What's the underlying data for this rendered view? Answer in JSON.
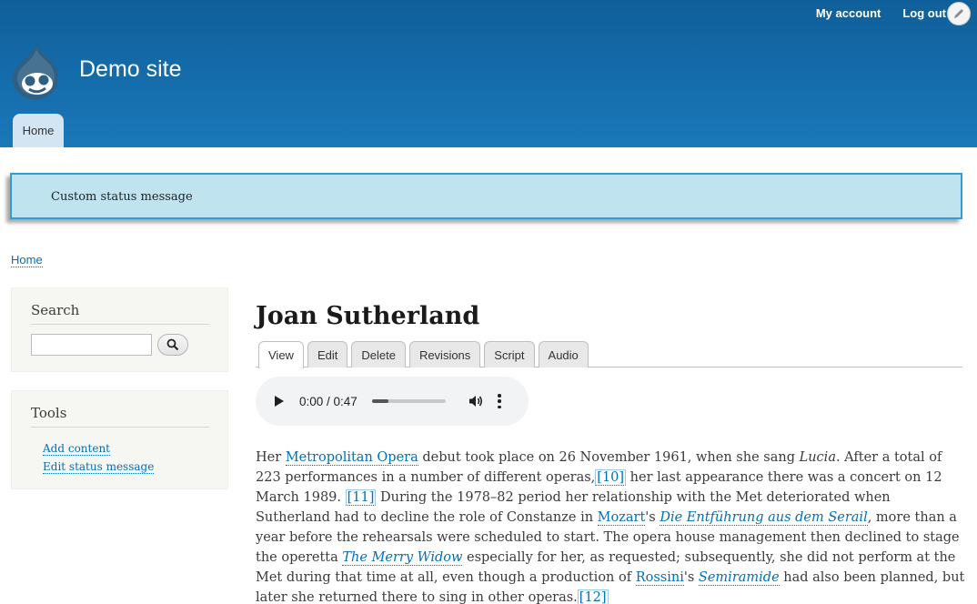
{
  "header": {
    "site_name": "Demo site",
    "secondary_menu": [
      "My account",
      "Log out"
    ],
    "primary_menu": [
      "Home"
    ],
    "colors": {
      "brand_top": "#0f5f9a",
      "brand_bottom": "#1a78b9"
    }
  },
  "status_message": "Custom status message",
  "breadcrumb": [
    "Home"
  ],
  "sidebar": {
    "search": {
      "title": "Search",
      "input_value": ""
    },
    "tools": {
      "title": "Tools",
      "links": [
        "Add content",
        "Edit status message"
      ]
    }
  },
  "main": {
    "title": "Joan Sutherland",
    "tabs": [
      "View",
      "Edit",
      "Delete",
      "Revisions",
      "Script",
      "Audio"
    ],
    "active_tab": "View",
    "audio": {
      "time": "0:00 / 0:47",
      "progress": 0.22
    },
    "body": {
      "t1": "Her ",
      "l1": "Metropolitan Opera",
      "t2": " debut took place on 26 November 1961, when she sang ",
      "i1": "Lucia",
      "t3": ". After a total of 223 performances in a number of different operas,",
      "r10": "[10]",
      "t4": " her last appearance there was a concert on 12 March 1989. ",
      "r11": "[11]",
      "t5": " During the 1978–82 period her relationship with the Met deteriorated when Sutherland had to decline the role of Constanze in ",
      "l2": "Mozart",
      "t6": "'s ",
      "l3": "Die Entführung aus dem Serail",
      "t7": ", more than a year before the rehearsals were scheduled to start. The opera house management then declined to stage the operetta ",
      "l4": "The Merry Widow",
      "t8": " especially for her, as requested; subsequently, she did not perform at the Met during that time at all, even though a production of ",
      "l5": "Rossini",
      "t9": "'s ",
      "l6": "Semiramide",
      "t10": " had also been planned, but later she returned there to sing in other operas.",
      "r12": "[12]"
    }
  }
}
